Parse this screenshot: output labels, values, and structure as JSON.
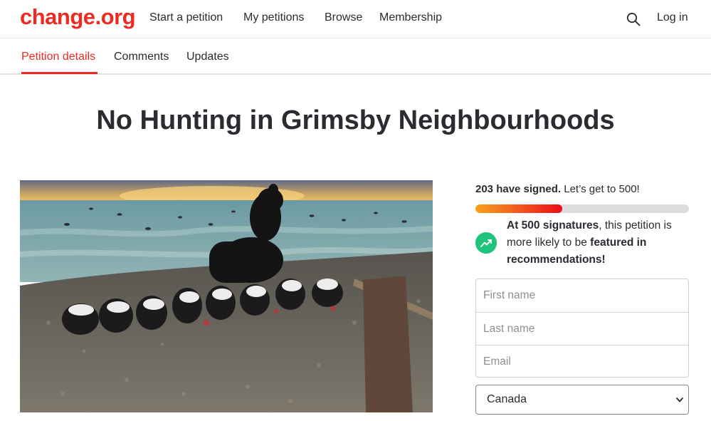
{
  "brand": {
    "logo": "change.org"
  },
  "nav": {
    "start_petition": "Start a petition",
    "my_petitions": "My petitions",
    "browse": "Browse",
    "membership": "Membership",
    "login": "Log in"
  },
  "tabs": {
    "details": "Petition details",
    "comments": "Comments",
    "updates": "Updates"
  },
  "petition": {
    "title": "No Hunting in Grimsby Neighbourhoods",
    "signed_strong": "203 have signed.",
    "signed_goal": " Let’s get to 500!",
    "progress_fraction": 0.406,
    "milestone": {
      "strong1": "At 500 signatures",
      "text1": ", this petition is more likely to be ",
      "strong2": "featured in recommendations!"
    }
  },
  "form": {
    "first_name_placeholder": "First name",
    "last_name_placeholder": "Last name",
    "email_placeholder": "Email",
    "country": "Canada"
  },
  "colors": {
    "brand_red": "#ec2c22",
    "progress_start": "#f7a21b",
    "progress_end": "#ec0c17",
    "success_green": "#1ec47a"
  },
  "icons": [
    "search-icon",
    "trending-up-icon",
    "chevron-down-icon"
  ]
}
